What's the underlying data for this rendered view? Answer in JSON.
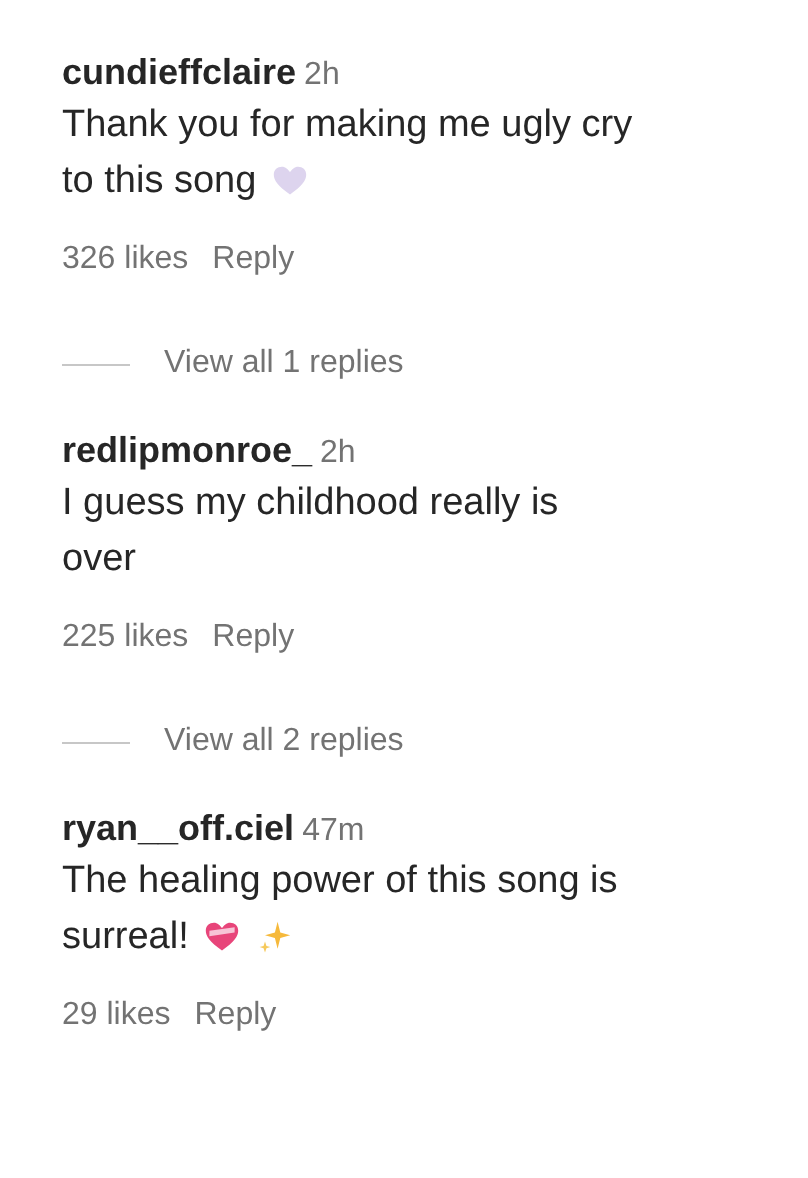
{
  "comments": [
    {
      "username": "cundieffclaire",
      "time": "2h",
      "text_lines": [
        "Thank you for making me ugly cry",
        "to this song"
      ],
      "emojis": [
        {
          "kind": "pale-heart"
        }
      ],
      "likes": "326 likes",
      "reply": "Reply",
      "view_replies": "View all 1 replies"
    },
    {
      "username": "redlipmonroe_",
      "time": "2h",
      "text_lines": [
        "I guess my childhood really is",
        "over"
      ],
      "likes": "225 likes",
      "reply": "Reply",
      "view_replies": "View all 2 replies"
    },
    {
      "username": "ryan__off.ciel",
      "time": "47m",
      "text_lines": [
        "The healing power of this song is",
        "surreal!"
      ],
      "emojis": [
        {
          "kind": "pink-heart"
        },
        {
          "kind": "sparkles"
        }
      ],
      "likes": "29 likes",
      "reply": "Reply"
    }
  ]
}
